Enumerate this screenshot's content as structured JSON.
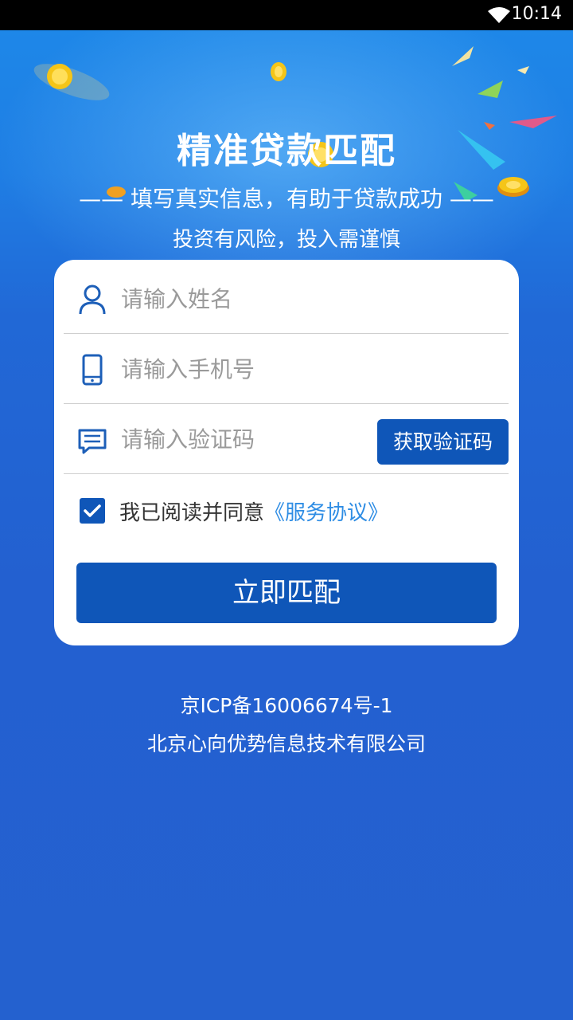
{
  "status_bar": {
    "time": "10:14"
  },
  "hero": {
    "title": "精准贷款匹配",
    "subtitle": "—— 填写真实信息，有助于贷款成功 ——",
    "risk_notice": "投资有风险，投入需谨慎"
  },
  "form": {
    "name_placeholder": "请输入姓名",
    "phone_placeholder": "请输入手机号",
    "code_placeholder": "请输入验证码",
    "get_code_label": "获取验证码",
    "agree_checked": true,
    "agree_text": "我已阅读并同意",
    "agreement_link": "《服务协议》",
    "submit_label": "立即匹配"
  },
  "footer": {
    "icp": "京ICP备16006674号-1",
    "company": "北京心向优势信息技术有限公司"
  },
  "colors": {
    "primary": "#0f56b8",
    "link": "#2f8de4",
    "background": "#2560d3"
  }
}
